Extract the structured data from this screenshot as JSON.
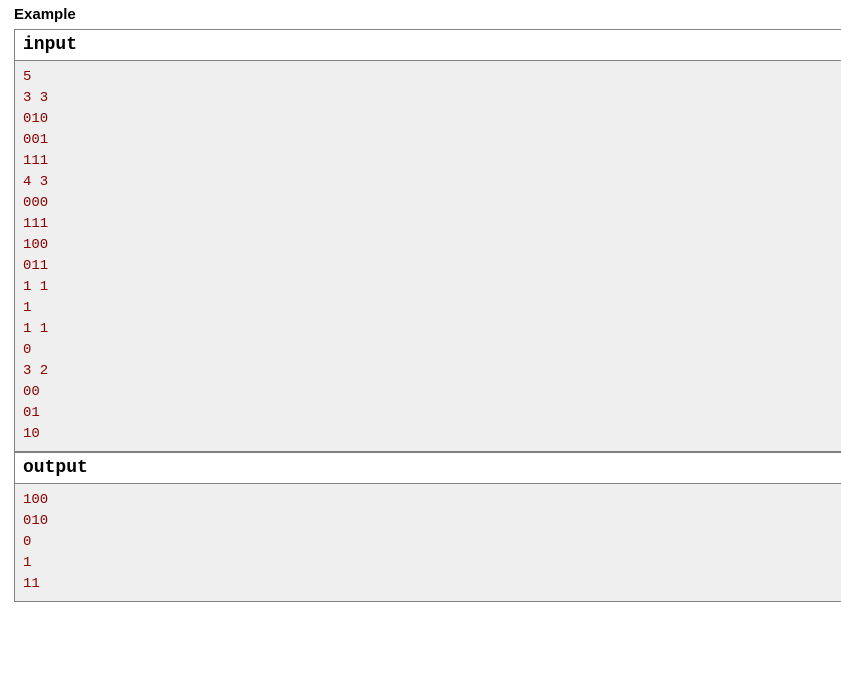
{
  "section": {
    "title": "Example"
  },
  "blocks": {
    "input": {
      "label": "input",
      "content": "5\n3 3\n010\n001\n111\n4 3\n000\n111\n100\n011\n1 1\n1\n1 1\n0\n3 2\n00\n01\n10"
    },
    "output": {
      "label": "output",
      "content": "100\n010\n0\n1\n11"
    }
  }
}
